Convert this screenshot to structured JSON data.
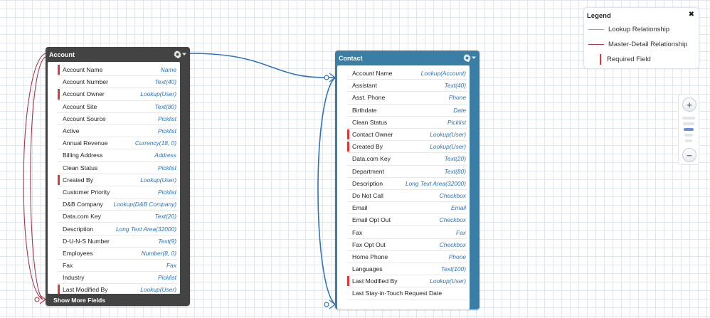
{
  "legend": {
    "title": "Legend",
    "close_glyph": "✖",
    "lookup_label": "Lookup Relationship",
    "master_detail_label": "Master-Detail Relationship",
    "required_label": "Required Field",
    "lookup_color": "#7ab0c8",
    "master_detail_color": "#a8374d",
    "required_color": "#d83a3a"
  },
  "zoom": {
    "zoom_in_label": "+",
    "zoom_out_label": "−",
    "level_count": 5,
    "current_level": 3,
    "active_color": "#6f8fd4"
  },
  "account": {
    "title": "Account",
    "show_more_label": "Show More Fields",
    "header_color": "#434343",
    "fields": [
      {
        "name": "Account Name",
        "type": "Name",
        "required": true
      },
      {
        "name": "Account Number",
        "type": "Text(40)",
        "required": false
      },
      {
        "name": "Account Owner",
        "type": "Lookup(User)",
        "required": true
      },
      {
        "name": "Account Site",
        "type": "Text(80)",
        "required": false
      },
      {
        "name": "Account Source",
        "type": "Picklist",
        "required": false
      },
      {
        "name": "Active",
        "type": "Picklist",
        "required": false
      },
      {
        "name": "Annual Revenue",
        "type": "Currency(18, 0)",
        "required": false
      },
      {
        "name": "Billing Address",
        "type": "Address",
        "required": false
      },
      {
        "name": "Clean Status",
        "type": "Picklist",
        "required": false
      },
      {
        "name": "Created By",
        "type": "Lookup(User)",
        "required": true
      },
      {
        "name": "Customer Priority",
        "type": "Picklist",
        "required": false
      },
      {
        "name": "D&B Company",
        "type": "Lookup(D&B Company)",
        "required": false
      },
      {
        "name": "Data.com Key",
        "type": "Text(20)",
        "required": false
      },
      {
        "name": "Description",
        "type": "Long Text Area(32000)",
        "required": false
      },
      {
        "name": "D-U-N-S Number",
        "type": "Text(9)",
        "required": false
      },
      {
        "name": "Employees",
        "type": "Number(8, 0)",
        "required": false
      },
      {
        "name": "Fax",
        "type": "Fax",
        "required": false
      },
      {
        "name": "Industry",
        "type": "Picklist",
        "required": false
      },
      {
        "name": "Last Modified By",
        "type": "Lookup(User)",
        "required": true
      }
    ]
  },
  "contact": {
    "title": "Contact",
    "header_color": "#3a7ea6",
    "fields": [
      {
        "name": "Account Name",
        "type": "Lookup(Account)",
        "required": false
      },
      {
        "name": "Assistant",
        "type": "Text(40)",
        "required": false
      },
      {
        "name": "Asst. Phone",
        "type": "Phone",
        "required": false
      },
      {
        "name": "Birthdate",
        "type": "Date",
        "required": false
      },
      {
        "name": "Clean Status",
        "type": "Picklist",
        "required": false
      },
      {
        "name": "Contact Owner",
        "type": "Lookup(User)",
        "required": true
      },
      {
        "name": "Created By",
        "type": "Lookup(User)",
        "required": true
      },
      {
        "name": "Data.com Key",
        "type": "Text(20)",
        "required": false
      },
      {
        "name": "Department",
        "type": "Text(80)",
        "required": false
      },
      {
        "name": "Description",
        "type": "Long Text Area(32000)",
        "required": false
      },
      {
        "name": "Do Not Call",
        "type": "Checkbox",
        "required": false
      },
      {
        "name": "Email",
        "type": "Email",
        "required": false
      },
      {
        "name": "Email Opt Out",
        "type": "Checkbox",
        "required": false
      },
      {
        "name": "Fax",
        "type": "Fax",
        "required": false
      },
      {
        "name": "Fax Opt Out",
        "type": "Checkbox",
        "required": false
      },
      {
        "name": "Home Phone",
        "type": "Phone",
        "required": false
      },
      {
        "name": "Languages",
        "type": "Text(100)",
        "required": false
      },
      {
        "name": "Last Modified By",
        "type": "Lookup(User)",
        "required": true
      },
      {
        "name": "Last Stay-in-Touch Request Date",
        "type": "",
        "required": false
      }
    ]
  },
  "icons": {
    "gear": "gear-icon",
    "dropdown": "chevron-down-icon"
  }
}
